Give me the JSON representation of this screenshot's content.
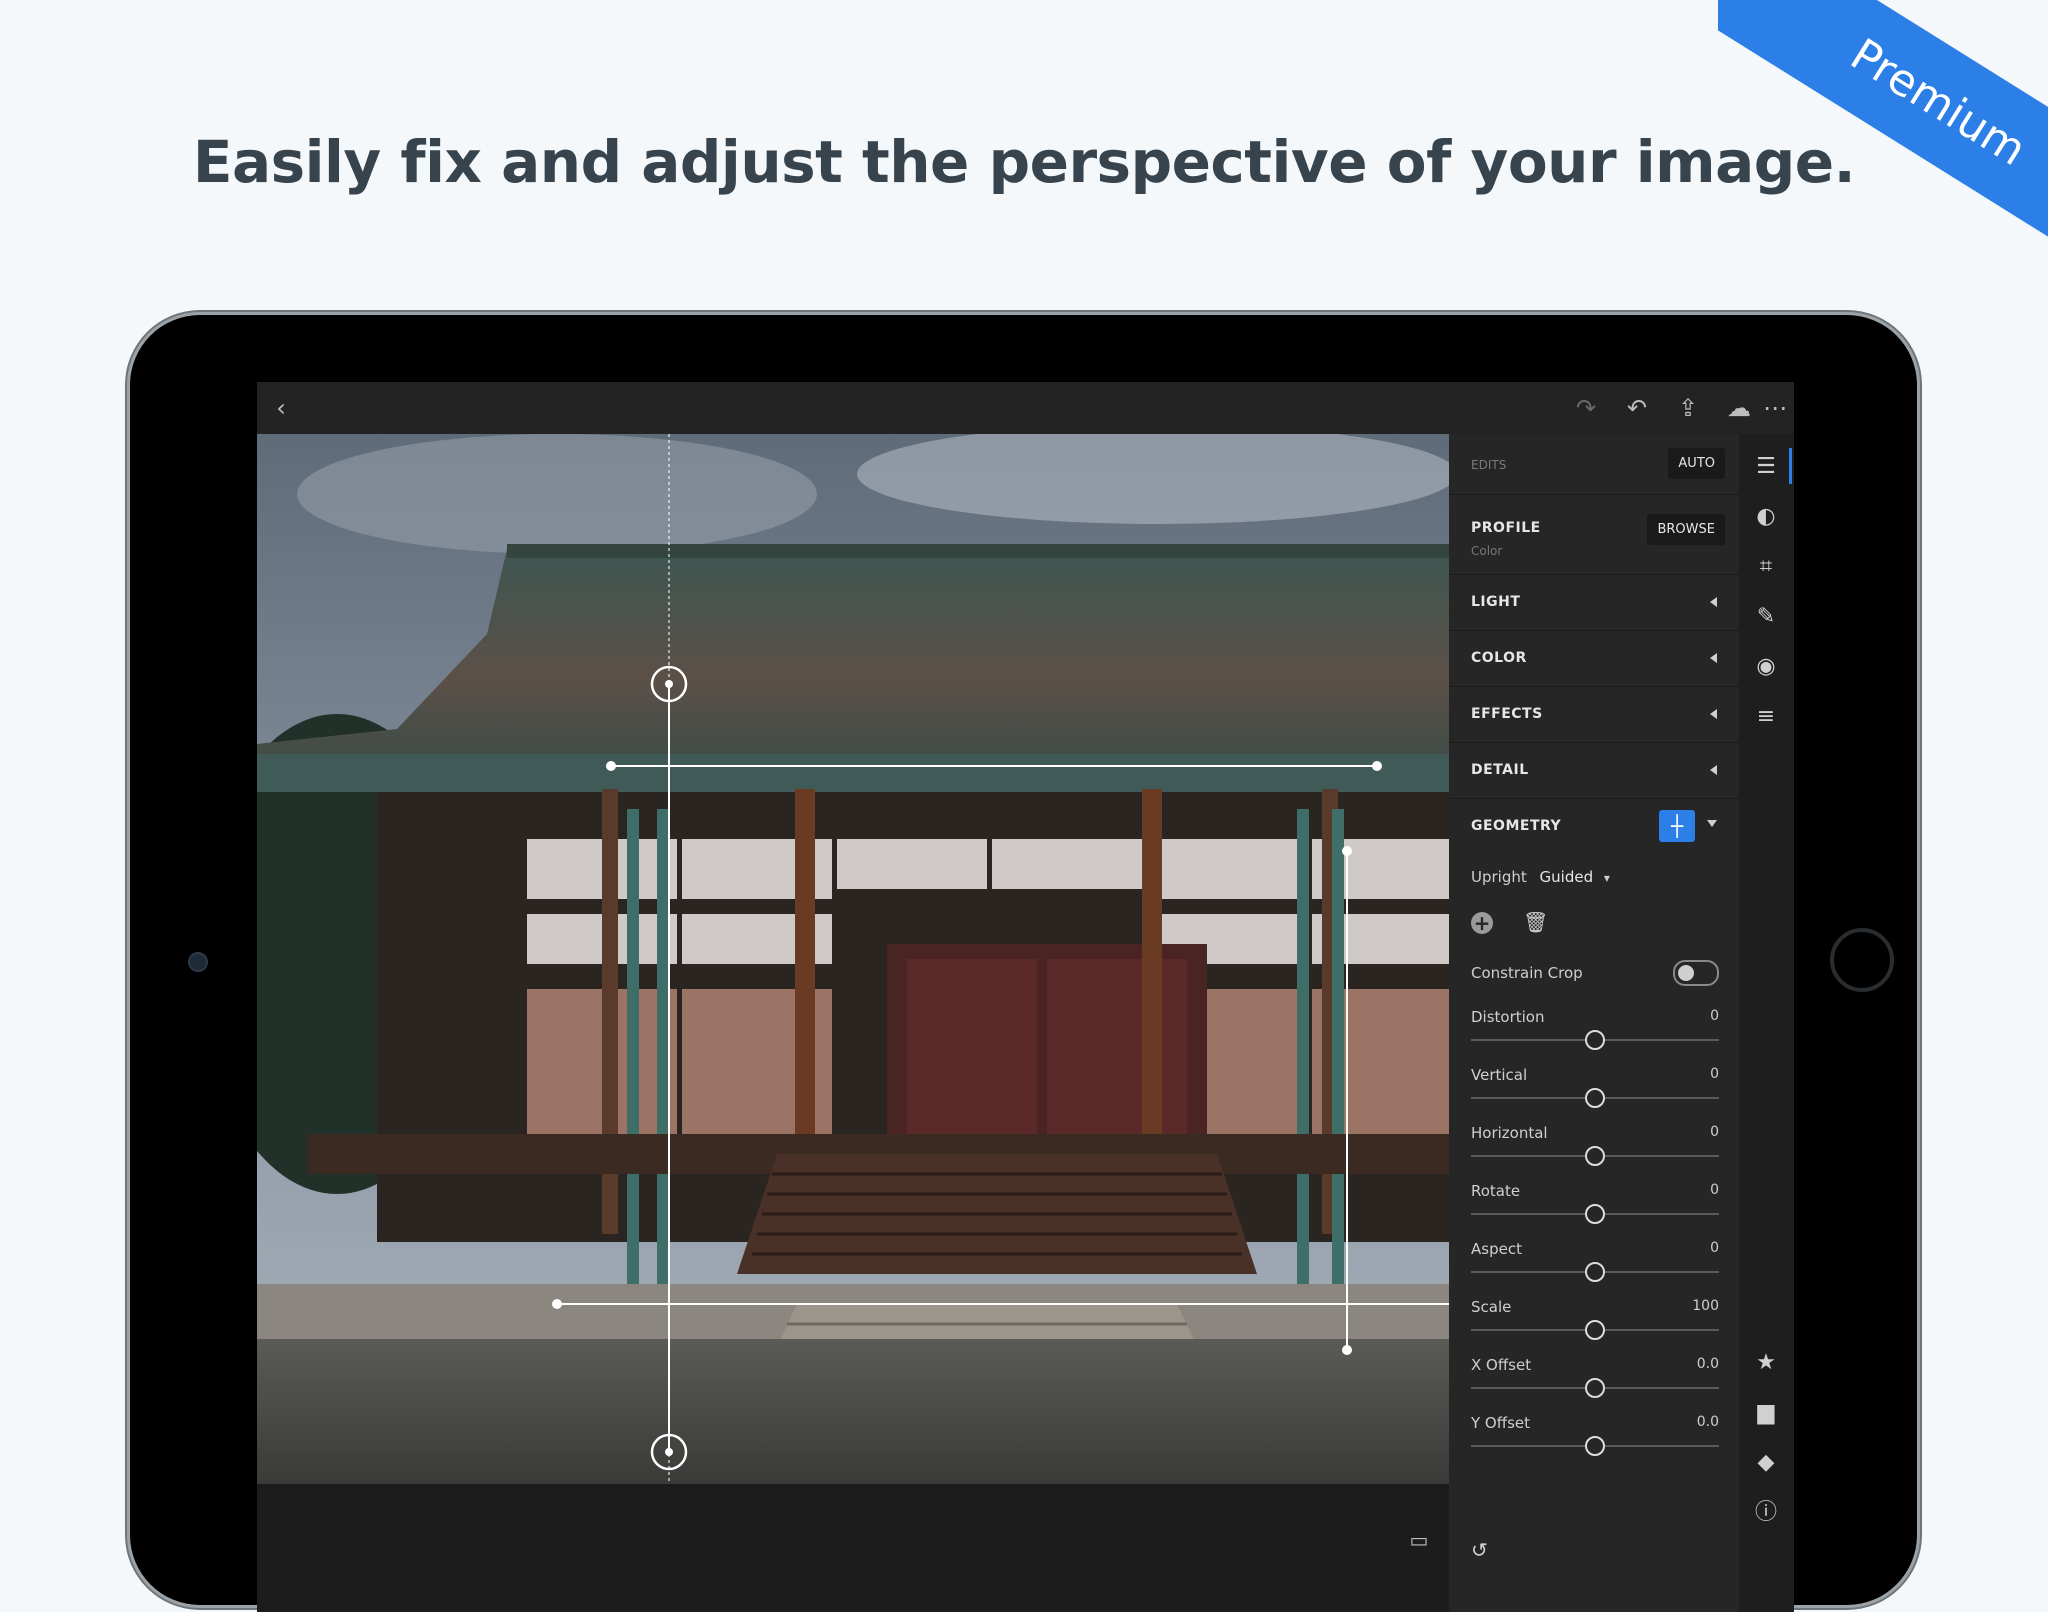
{
  "headline": "Easily fix and adjust the perspective of your image.",
  "ribbon": "Premium",
  "topbar": {
    "back_icon": "chevron-left-icon",
    "redo_icon": "redo-icon",
    "undo_icon": "undo-icon",
    "share_icon": "share-icon",
    "cloud_icon": "cloud-synced-icon",
    "more_icon": "more-icon"
  },
  "panel": {
    "edits_label": "EDITS",
    "auto_label": "AUTO",
    "profile_label": "PROFILE",
    "profile_value": "Color",
    "browse_label": "BROWSE",
    "sections": [
      "LIGHT",
      "COLOR",
      "EFFECTS",
      "DETAIL"
    ],
    "geometry_label": "GEOMETRY",
    "upright_label": "Upright",
    "upright_value": "Guided",
    "constrain_crop_label": "Constrain Crop",
    "constrain_crop_on": false,
    "sliders": [
      {
        "label": "Distortion",
        "value": "0",
        "position": 0.5
      },
      {
        "label": "Vertical",
        "value": "0",
        "position": 0.5
      },
      {
        "label": "Horizontal",
        "value": "0",
        "position": 0.5
      },
      {
        "label": "Rotate",
        "value": "0",
        "position": 0.5
      },
      {
        "label": "Aspect",
        "value": "0",
        "position": 0.5
      },
      {
        "label": "Scale",
        "value": "100",
        "position": 0.5
      },
      {
        "label": "X Offset",
        "value": "0.0",
        "position": 0.5
      },
      {
        "label": "Y Offset",
        "value": "0.0",
        "position": 0.5
      }
    ]
  },
  "rail_icons": [
    "edit-sliders-icon",
    "selective-icon",
    "crop-icon",
    "healing-icon",
    "vignette-icon",
    "presets-icon",
    "star-icon",
    "comment-icon",
    "tag-icon",
    "info-icon"
  ],
  "colors": {
    "accent": "#2b7fe6",
    "background": "#f4f8fa",
    "panel": "#262626"
  }
}
